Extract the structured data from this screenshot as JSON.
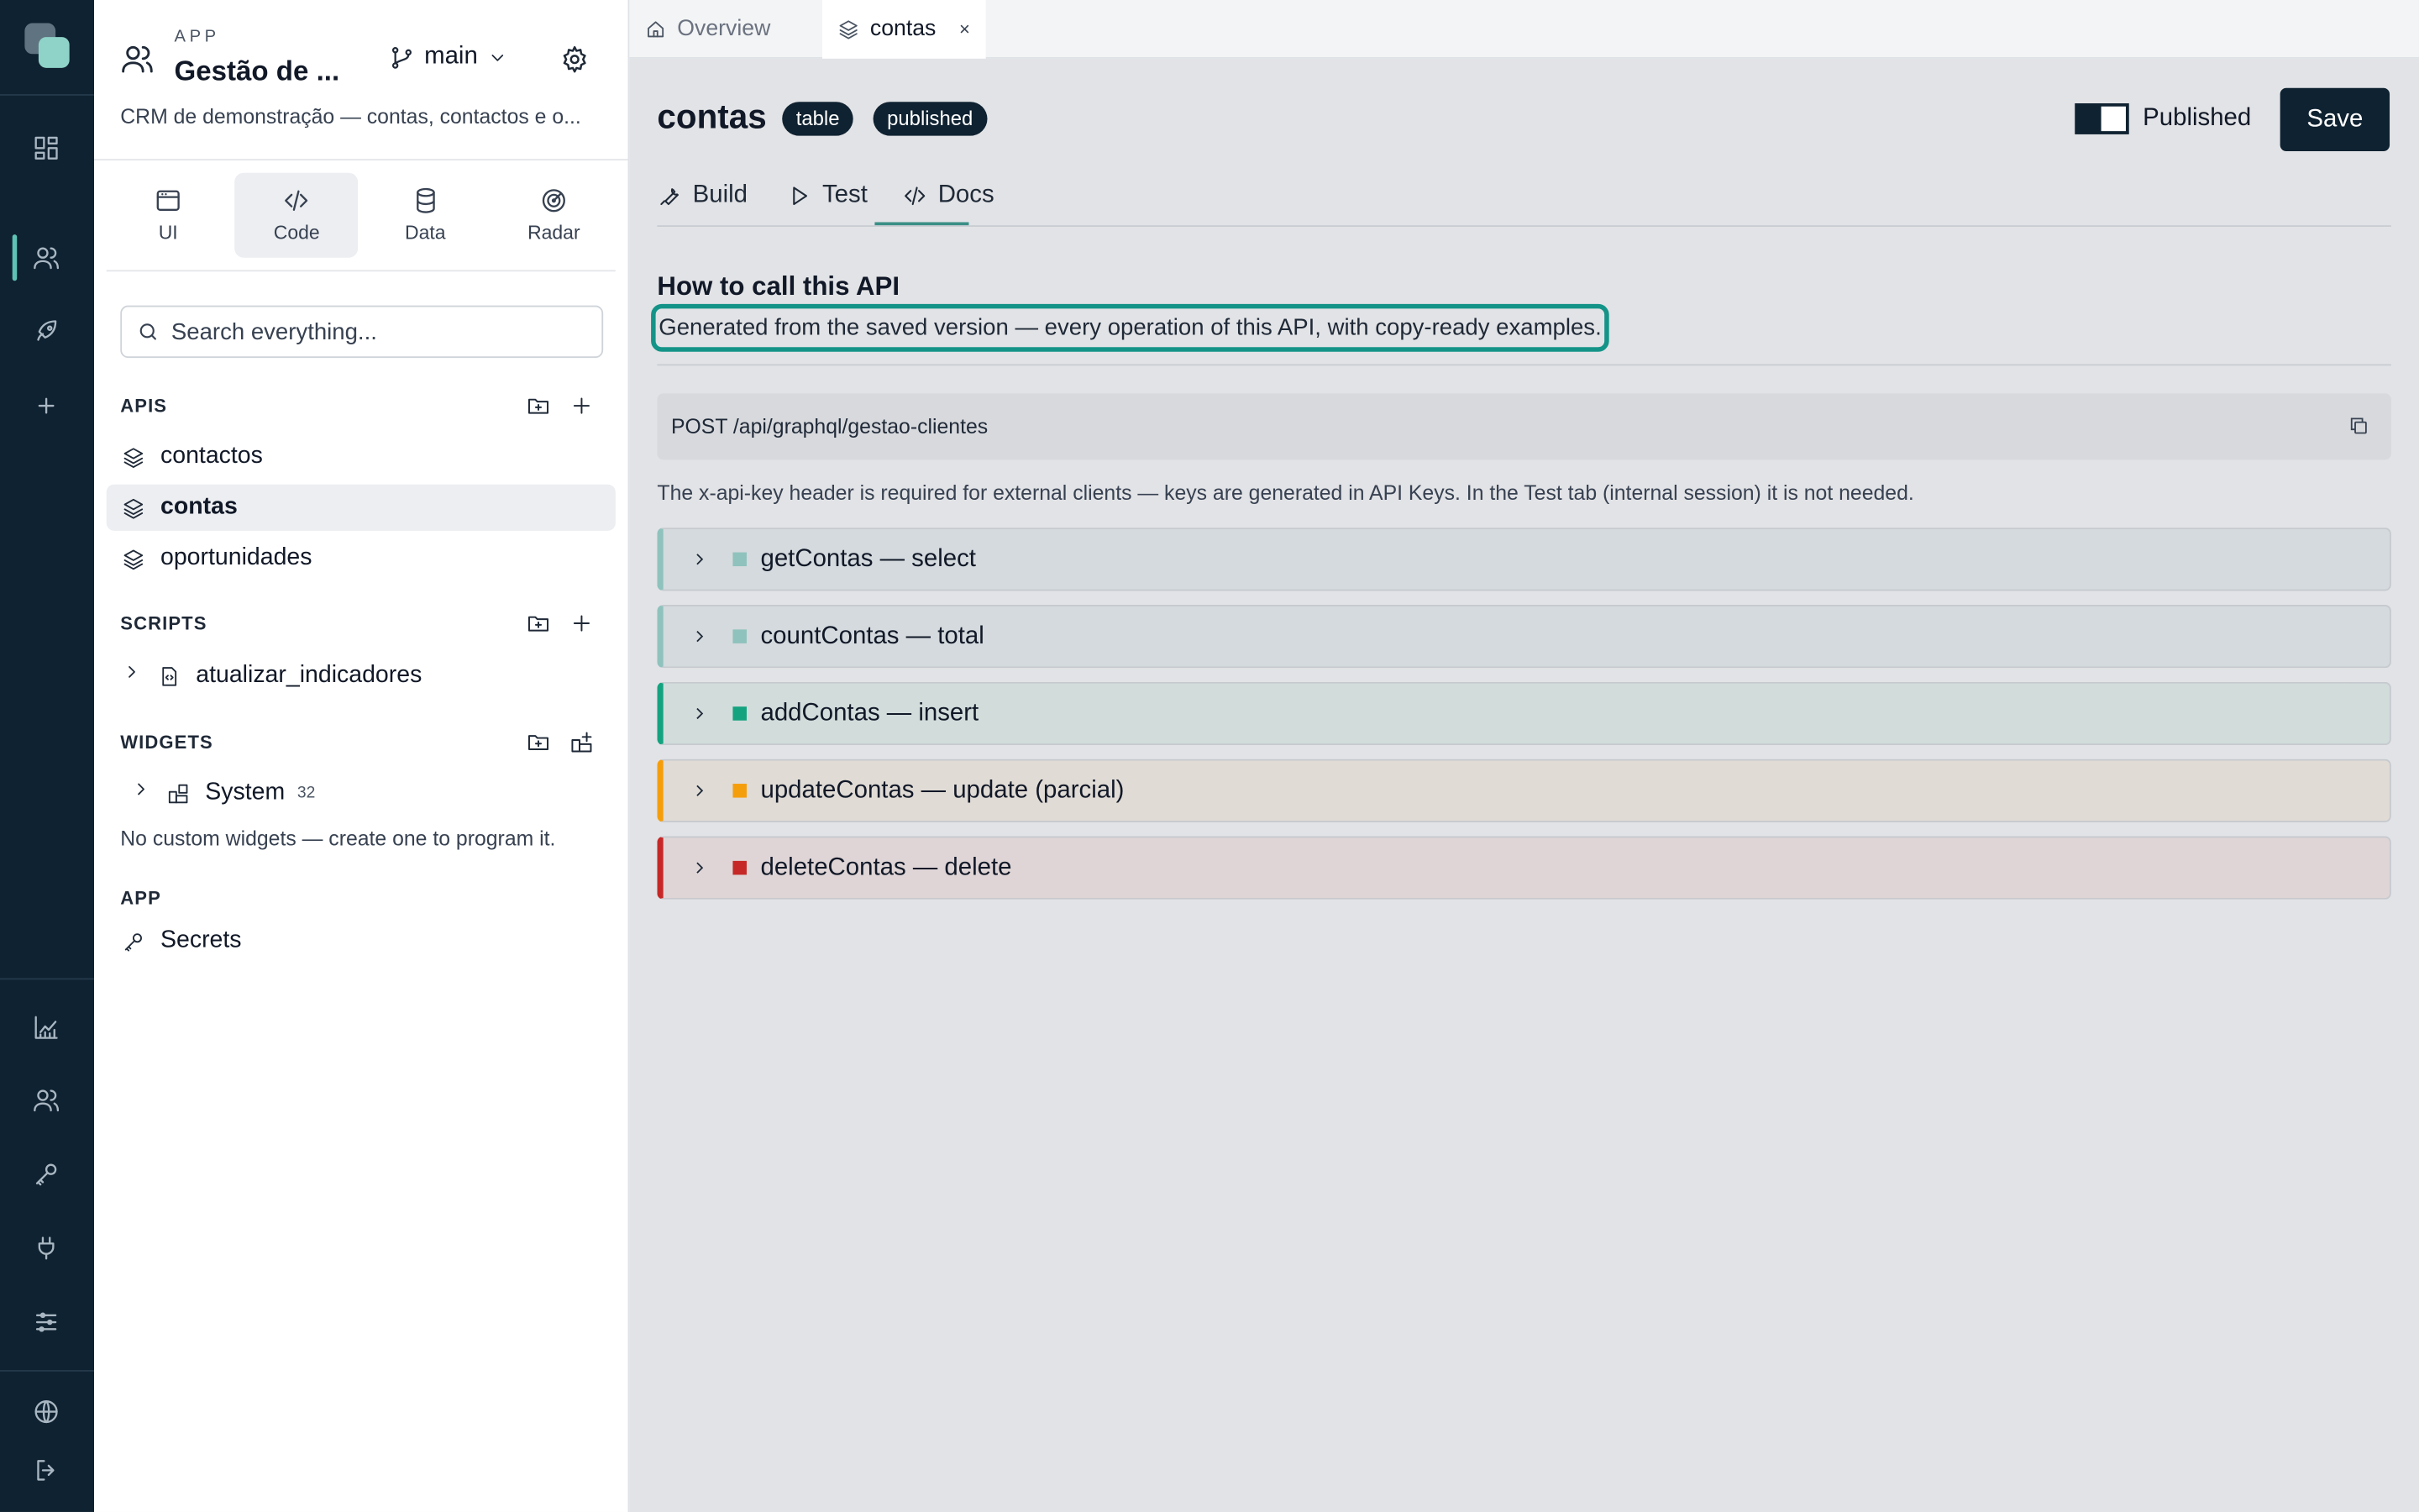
{
  "colors": {
    "rail_bg": "#0f2231",
    "accent": "#149488",
    "op_select": "#8fc2bd",
    "op_insert": "#14a37f",
    "op_update": "#f59e0b",
    "op_delete": "#c62828"
  },
  "rail": {
    "icons": [
      "dashboard-icon",
      "users-icon",
      "rocket-icon",
      "plus-icon",
      "chart-icon",
      "team-icon",
      "key-icon",
      "plug-icon",
      "sliders-icon",
      "globe-icon",
      "logout-icon"
    ]
  },
  "app": {
    "kicker": "APP",
    "name": "Gestão de ...",
    "branch": "main",
    "description": "CRM de demonstração — contas, contactos e o..."
  },
  "modes": [
    {
      "label": "UI",
      "icon": "window-icon"
    },
    {
      "label": "Code",
      "icon": "code-icon",
      "active": true
    },
    {
      "label": "Data",
      "icon": "database-icon"
    },
    {
      "label": "Radar",
      "icon": "radar-icon"
    }
  ],
  "search": {
    "placeholder": "Search everything..."
  },
  "sections": {
    "apis": {
      "title": "APIS",
      "items": [
        "contactos",
        "contas",
        "oportunidades"
      ],
      "selected": "contas"
    },
    "scripts": {
      "title": "SCRIPTS",
      "items": [
        "atualizar_indicadores"
      ]
    },
    "widgets": {
      "title": "WIDGETS",
      "system_label": "System",
      "system_count": "32",
      "note": "No custom widgets — create one to program it."
    },
    "app": {
      "title": "APP",
      "secrets": "Secrets"
    }
  },
  "file_tabs": [
    {
      "label": "Overview",
      "icon": "home-icon"
    },
    {
      "label": "contas",
      "icon": "layers-icon",
      "active": true,
      "close": "×"
    }
  ],
  "header": {
    "title": "contas",
    "badges": [
      "table",
      "published"
    ],
    "toggle_label": "Published",
    "save_label": "Save"
  },
  "subtabs": [
    {
      "label": "Build",
      "icon": "wrench-icon"
    },
    {
      "label": "Test",
      "icon": "play-icon"
    },
    {
      "label": "Docs",
      "icon": "code-icon",
      "active": true
    }
  ],
  "docs": {
    "heading": "How to call this API",
    "subtitle": "Generated from the saved version — every operation of this API, with copy-ready examples.",
    "endpoint": "POST /api/graphql/gestao-clientes",
    "help": "The x-api-key header is required for external clients — keys are generated in API Keys. In the Test tab (internal session) it is not needed.",
    "operations": [
      {
        "label": "getContas — select",
        "kind": "select"
      },
      {
        "label": "countContas — total",
        "kind": "select"
      },
      {
        "label": "addContas — insert",
        "kind": "insert"
      },
      {
        "label": "updateContas — update (parcial)",
        "kind": "update"
      },
      {
        "label": "deleteContas — delete",
        "kind": "delete"
      }
    ]
  }
}
